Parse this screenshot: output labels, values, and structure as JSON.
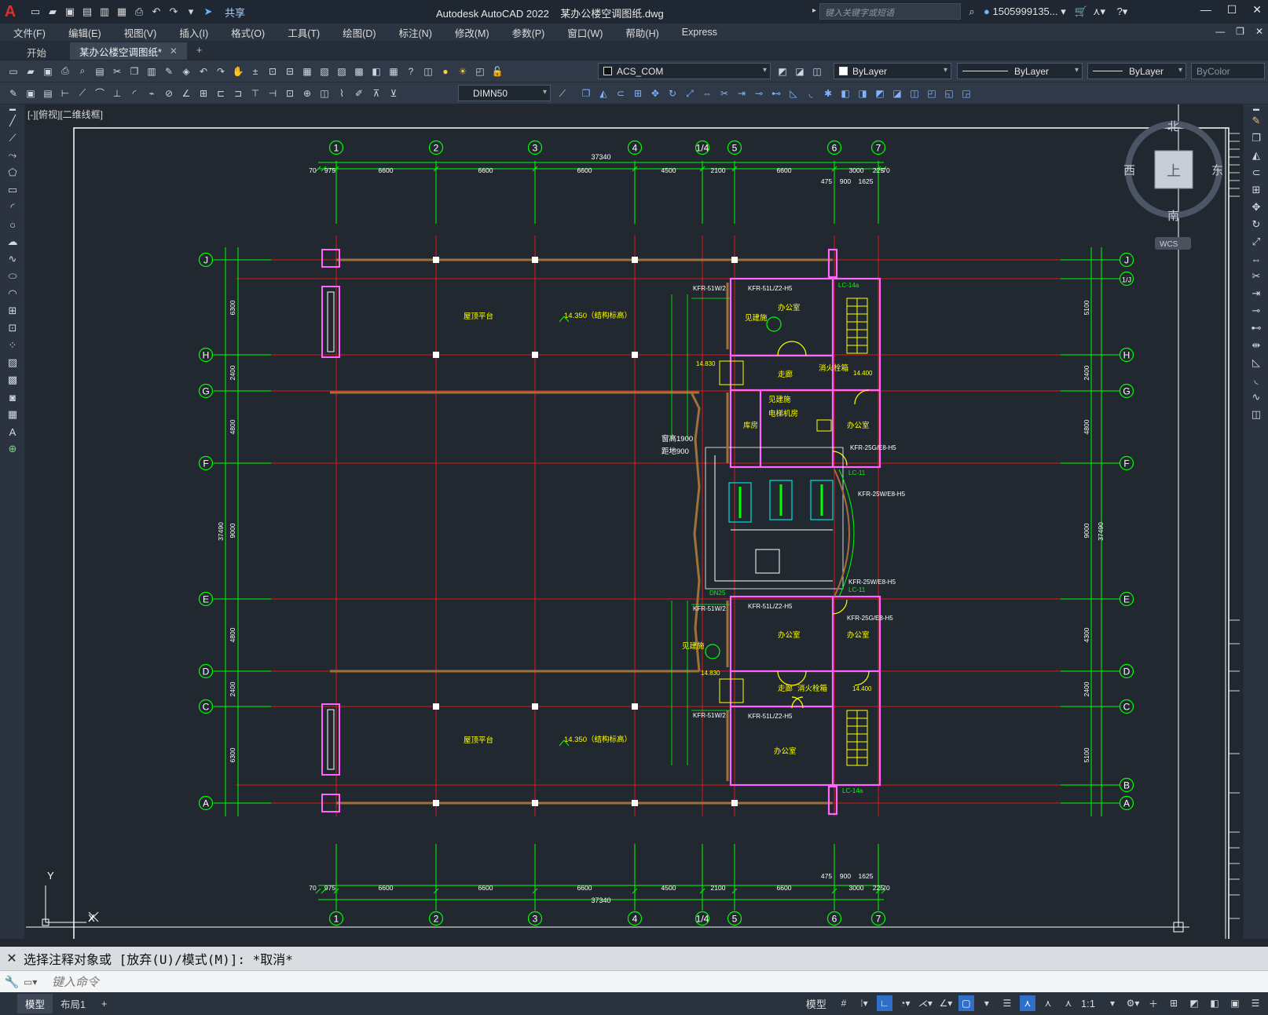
{
  "app": {
    "logo": "A",
    "title": "Autodesk AutoCAD 2022",
    "filename": "某办公楼空调图纸.dwg",
    "share_label": "共享",
    "search_placeholder": "键入关键字或短语",
    "user": "1505999135...",
    "window_controls": [
      "—",
      "☐",
      "✕"
    ]
  },
  "menu": {
    "items": [
      "文件(F)",
      "编辑(E)",
      "视图(V)",
      "插入(I)",
      "格式(O)",
      "工具(T)",
      "绘图(D)",
      "标注(N)",
      "修改(M)",
      "参数(P)",
      "窗口(W)",
      "帮助(H)",
      "Express"
    ],
    "mdi_controls": [
      "—",
      "❐",
      "✕"
    ]
  },
  "tabs": {
    "start": "开始",
    "active": "某办公楼空调图纸*",
    "close": "✕",
    "add": "+"
  },
  "toolbar": {
    "layer": "ACS_COM",
    "color": "ByLayer",
    "linetype": "ByLayer",
    "lineweight": "ByLayer",
    "plotstyle": "ByColor",
    "dimstyle": "DIMN50"
  },
  "view": {
    "label": "[-][俯视][二维线框]",
    "viewcube": {
      "top": "上",
      "north": "北",
      "south": "南",
      "east": "东",
      "west": "西",
      "wcs": "WCS"
    },
    "ucs": {
      "x": "X",
      "y": "Y"
    }
  },
  "drawing": {
    "col_axes": [
      "1",
      "2",
      "3",
      "4",
      "1/4",
      "5",
      "6",
      "7"
    ],
    "row_axes": [
      "J",
      "1/J",
      "H",
      "G",
      "F",
      "E",
      "D",
      "C",
      "B",
      "A"
    ],
    "total_width": "37340",
    "total_height": "37490",
    "top_dims": [
      "70",
      "975",
      "6600",
      "6600",
      "6600",
      "4500",
      "2100",
      "6600",
      "3000",
      "225",
      "70"
    ],
    "top_dims_sub": [
      "475",
      "900",
      "1625"
    ],
    "left_dims": [
      "6300",
      "2400",
      "4800",
      "9000",
      "4800",
      "2400",
      "6300"
    ],
    "right_dims": [
      "5100",
      "2400",
      "4800",
      "9000",
      "4300",
      "2400",
      "5100"
    ],
    "labels": {
      "roof_terrace_1": "屋顶平台",
      "roof_terrace_2": "屋顶平台",
      "elevation_1": "14.350（结构标高）",
      "elevation_2": "14.350（结构标高）",
      "office_1": "办公室",
      "office_2": "办公室",
      "office_3": "办公室",
      "office_4": "办公室",
      "office_5": "办公室",
      "corridor_1": "走廊",
      "corridor_2": "走廊",
      "fire_hydrant_1": "消火栓箱",
      "fire_hydrant_2": "消火栓箱",
      "elevator_room": "电梯机房",
      "see_building": "见建施",
      "unit_kfr1": "KFR-51L/Z2-H5",
      "unit_kfr2": "KFR-25G/E8-H5",
      "unit_kfr3": "KFR-25W/E8-H5",
      "unit_kfr4": "KFR-51W/2",
      "lc_label": "LC-14a",
      "lc11": "LC-11",
      "dim_1900": "窗高1900",
      "dim_900": "距地900",
      "pipe": "DN25",
      "storeroom": "库房",
      "h14400": "14.400",
      "h14830": "14.830"
    }
  },
  "command": {
    "history": "选择注释对象或 [放弃(U)/模式(M)]: *取消*",
    "placeholder": "键入命令"
  },
  "status": {
    "model_tab": "模型",
    "layout_tab": "布局1",
    "add": "+",
    "model_label": "模型",
    "scale": "1:1"
  },
  "colors": {
    "grid_green": "#00ff00",
    "axis_red": "#e01818",
    "wall_magenta": "#ff66ff",
    "label_yellow": "#ffff00",
    "brown": "#a0703a",
    "canvas": "#212830"
  }
}
